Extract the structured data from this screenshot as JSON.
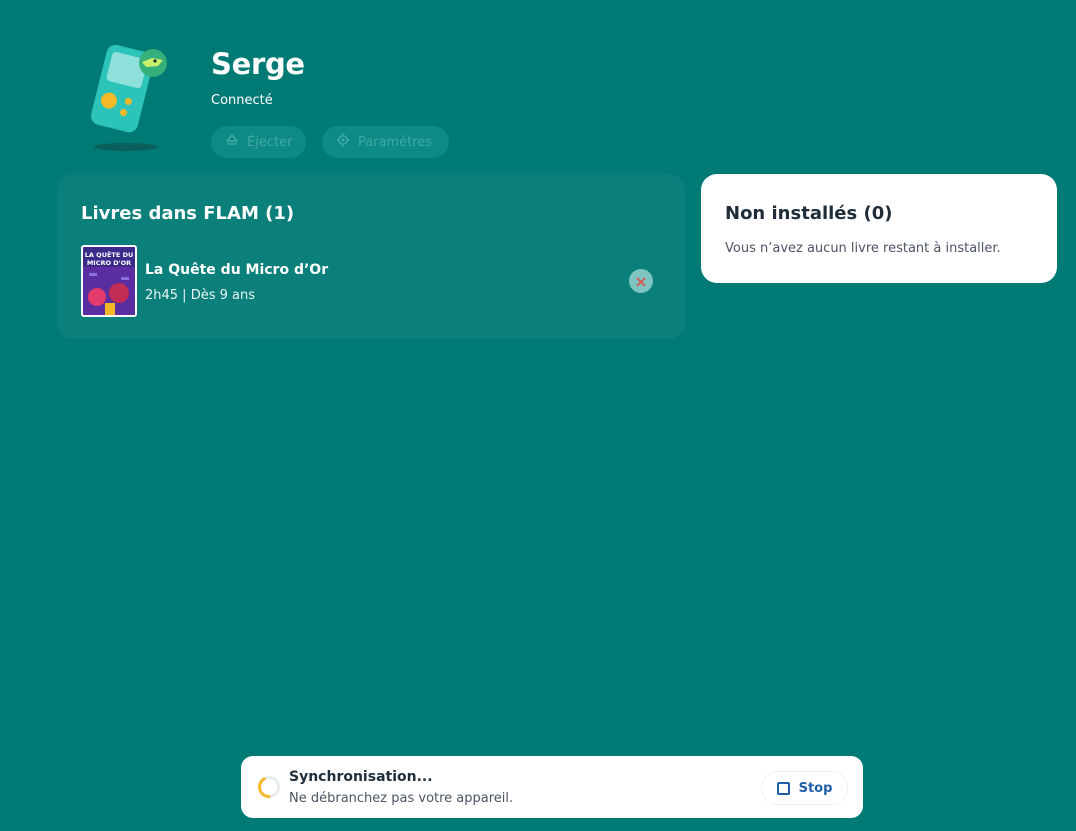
{
  "device": {
    "name": "Serge",
    "status": "Connecté",
    "illustration": "flam-device-illustration"
  },
  "actions": {
    "eject_label": "Éjecter",
    "eject_icon": "eject-icon",
    "settings_label": "Paramètres",
    "settings_icon": "gear-icon"
  },
  "installed": {
    "title": "Livres dans FLAM (1)",
    "books": [
      {
        "title": "La Quête du Micro d’Or",
        "meta": "2h45 | Dès 9 ans",
        "cover_text": "LA QUÊTE DU MICRO D'OR",
        "remove_icon": "close-icon"
      }
    ]
  },
  "pending": {
    "title": "Non installés (0)",
    "message": "Vous n’avez aucun livre restant à installer."
  },
  "sync": {
    "title": "Synchronisation...",
    "subtitle": "Ne débranchez pas votre appareil.",
    "stop_label": "Stop",
    "spinner_icon": "spinner-icon",
    "stop_icon": "stop-icon"
  },
  "colors": {
    "background": "#007a75",
    "card_dark": "#0b7f7a",
    "accent_blue": "#1f5fa8",
    "spinner_yellow": "#f5b829"
  }
}
